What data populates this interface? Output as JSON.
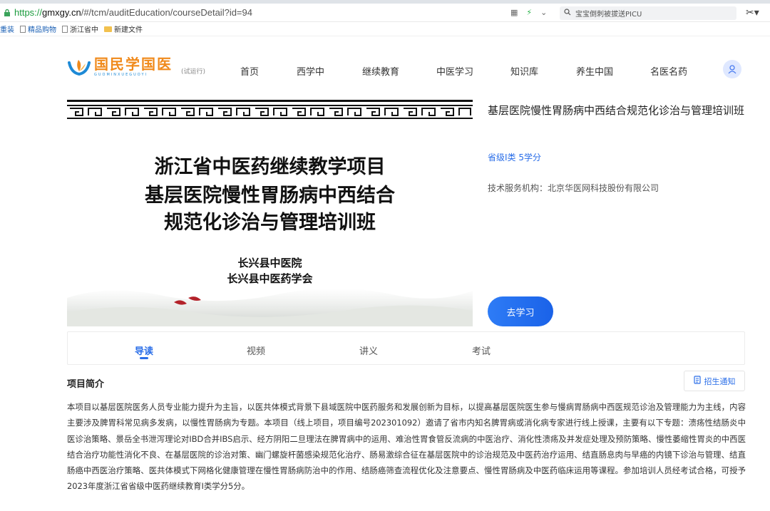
{
  "browser": {
    "url_scheme": "https://",
    "url_host": "gmxgy.cn",
    "url_path": "/#/tcm/auditEducation/courseDetail?id=94",
    "search_text": "宝宝倒刺被拔送PICU",
    "bookmarks": [
      "重装",
      "精品购物",
      "浙江省中",
      "新建文件"
    ]
  },
  "site": {
    "logo_cn": "国民学国医",
    "logo_pinyin": "GUOMINXUEGUOYI",
    "logo_trial": "(试运行)",
    "nav": [
      "首页",
      "西学中",
      "继续教育",
      "中医学习",
      "知识库",
      "养生中国",
      "名医名药"
    ]
  },
  "banner": {
    "line1": "浙江省中医药继续教学项目",
    "line2": "基层医院慢性胃肠病中西结合",
    "line3": "规范化诊治与管理培训班",
    "org1": "长兴县中医院",
    "org2": "长兴县中医药学会"
  },
  "course": {
    "title": "基层医院慢性胃肠病中西结合规范化诊治与管理培训班",
    "credit": "省级I类 5学分",
    "org": "技术服务机构：北京华医网科技股份有限公司",
    "study_button": "去学习"
  },
  "tabs": [
    "导读",
    "视频",
    "讲义",
    "考试"
  ],
  "active_tab": 0,
  "intro": {
    "title": "项目简介",
    "notice_button": "招生通知",
    "text": "本项目以基层医院医务人员专业能力提升为主旨，以医共体模式背景下县域医院中医药服务和发展创新为目标，以提高基层医院医生参与慢病胃肠病中西医规范诊治及管理能力为主线，内容主要涉及脾胃科常见病多发病，以慢性胃肠病为专题。本项目（线上项目，项目编号202301092）邀请了省市内知名脾胃病或消化病专家进行线上授课，主要有以下专题：溃疡性结肠炎中医诊治策略、景岳全书泄泻理论对IBD合并IBS启示、经方阴阳二旦理法在脾胃病中的运用、难治性胃食管反流病的中医治疗、消化性溃疡及并发症处理及预防策略、慢性萎缩性胃炎的中西医结合治疗功能性消化不良、在基层医院的诊治对策、幽门螺旋杆菌感染规范化治疗、肠易激综合征在基层医院中的诊治规范及中医药治疗运用、结直肠息肉与早癌的内镜下诊治与管理、结直肠癌中西医治疗策略、医共体模式下网格化健康管理在慢性胃肠病防治中的作用、结肠癌筛查流程优化及注意要点、慢性胃肠病及中医药临床运用等课程。参加培训人员经考试合格，可授予2023年度浙江省省级中医药继续教育Ⅰ类学分5分。"
  }
}
